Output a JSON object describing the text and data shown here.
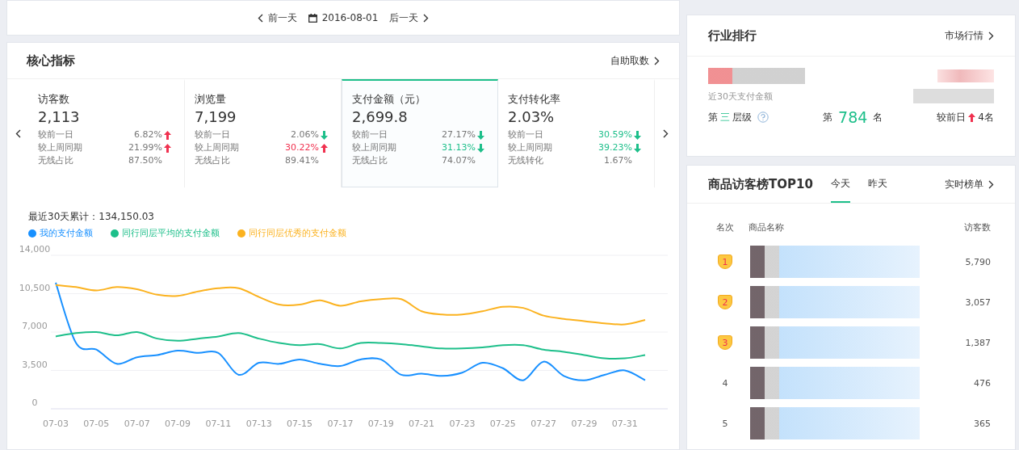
{
  "date_bar": {
    "prev": "前一天",
    "date": "2016-08-01",
    "next": "后一天"
  },
  "core": {
    "title": "核心指标",
    "link": "自助取数",
    "cards": [
      {
        "title": "访客数",
        "value": "2,113",
        "selected": false,
        "rows": [
          {
            "label": "较前一日",
            "value": "6.82%",
            "kind": "up",
            "highlighted": false
          },
          {
            "label": "较上周同期",
            "value": "21.99%",
            "kind": "up",
            "highlighted": false
          },
          {
            "label": "无线占比",
            "value": "87.50%",
            "kind": "plain",
            "highlighted": false
          }
        ]
      },
      {
        "title": "浏览量",
        "value": "7,199",
        "selected": false,
        "rows": [
          {
            "label": "较前一日",
            "value": "2.06%",
            "kind": "down",
            "highlighted": false
          },
          {
            "label": "较上周同期",
            "value": "30.22%",
            "kind": "up",
            "highlighted": true
          },
          {
            "label": "无线占比",
            "value": "89.41%",
            "kind": "plain",
            "highlighted": false
          }
        ]
      },
      {
        "title": "支付金额（元）",
        "value": "2,699.8",
        "selected": true,
        "rows": [
          {
            "label": "较前一日",
            "value": "27.17%",
            "kind": "down",
            "highlighted": false
          },
          {
            "label": "较上周同期",
            "value": "31.13%",
            "kind": "down",
            "highlighted": true
          },
          {
            "label": "无线占比",
            "value": "74.07%",
            "kind": "plain",
            "highlighted": false
          }
        ]
      },
      {
        "title": "支付转化率",
        "value": "2.03%",
        "selected": false,
        "rows": [
          {
            "label": "较前一日",
            "value": "30.59%",
            "kind": "down",
            "highlighted": true
          },
          {
            "label": "较上周同期",
            "value": "39.23%",
            "kind": "down",
            "highlighted": true
          },
          {
            "label": "无线转化",
            "value": "1.67%",
            "kind": "plain",
            "highlighted": false
          }
        ]
      }
    ],
    "total": "最近30天累计：134,150.03",
    "chart_data": {
      "type": "line",
      "categories": [
        "07-03",
        null,
        "07-05",
        null,
        "07-07",
        null,
        "07-09",
        null,
        "07-11",
        null,
        "07-13",
        null,
        "07-15",
        null,
        "07-17",
        null,
        "07-19",
        null,
        "07-21",
        null,
        "07-23",
        null,
        "07-25",
        null,
        "07-27",
        null,
        "07-29",
        null,
        "07-31",
        null
      ],
      "ylim": [
        0,
        14000
      ],
      "grid": true,
      "yticks": [
        0,
        {
          "value": 3500,
          "label": "3,500"
        },
        {
          "value": 7000,
          "label": "7,000"
        },
        {
          "value": 10500,
          "label": "10,500"
        },
        {
          "value": 14000,
          "label": "14,000"
        }
      ],
      "series": [
        {
          "name": "我的支付金额",
          "color": "#1890ff",
          "values": [
            11500,
            6000,
            5400,
            4100,
            4700,
            4900,
            5300,
            5100,
            5100,
            3100,
            4200,
            4100,
            4500,
            4100,
            3900,
            4500,
            4500,
            3100,
            3200,
            3000,
            3300,
            4200,
            3700,
            2600,
            4300,
            3000,
            2600,
            3100,
            3500,
            2600
          ]
        },
        {
          "name": "同行同层平均的支付金额",
          "color": "#1dbf8a",
          "values": [
            6600,
            6900,
            7000,
            6700,
            7000,
            6400,
            6200,
            6400,
            6600,
            6900,
            6400,
            6000,
            5800,
            5900,
            5500,
            6000,
            6000,
            5900,
            5700,
            5500,
            5500,
            5600,
            5800,
            5800,
            5400,
            5200,
            4900,
            4600,
            4600,
            4900
          ]
        },
        {
          "name": "同行同层优秀的支付金额",
          "color": "#fbb21f",
          "values": [
            11300,
            11100,
            10800,
            11100,
            10900,
            10400,
            10300,
            10700,
            11000,
            11000,
            10200,
            9500,
            9500,
            9900,
            9400,
            9800,
            10000,
            10000,
            8900,
            8600,
            8600,
            8900,
            9300,
            9200,
            8500,
            8200,
            8000,
            7800,
            7700,
            8100
          ]
        }
      ]
    }
  },
  "industry": {
    "title": "行业排行",
    "link": "市场行情",
    "caption": "近30天支付金额",
    "level_prefix": "第",
    "level": "三",
    "level_suffix": "层级",
    "rank_prefix": "第",
    "rank": "784",
    "rank_suffix": "名",
    "change_label": "较前日",
    "change": "4名"
  },
  "top10": {
    "title": "商品访客榜TOP10",
    "tabs": [
      {
        "label": "今天",
        "selected": true
      },
      {
        "label": "昨天",
        "selected": false
      }
    ],
    "link": "实时榜单",
    "columns": [
      "名次",
      "商品名称",
      "访客数"
    ],
    "rows": [
      {
        "rank": "1",
        "medal": true,
        "visitors": "5,790"
      },
      {
        "rank": "2",
        "medal": true,
        "visitors": "3,057"
      },
      {
        "rank": "3",
        "medal": true,
        "visitors": "1,387"
      },
      {
        "rank": "4",
        "medal": false,
        "visitors": "476"
      },
      {
        "rank": "5",
        "medal": false,
        "visitors": "365"
      }
    ]
  }
}
